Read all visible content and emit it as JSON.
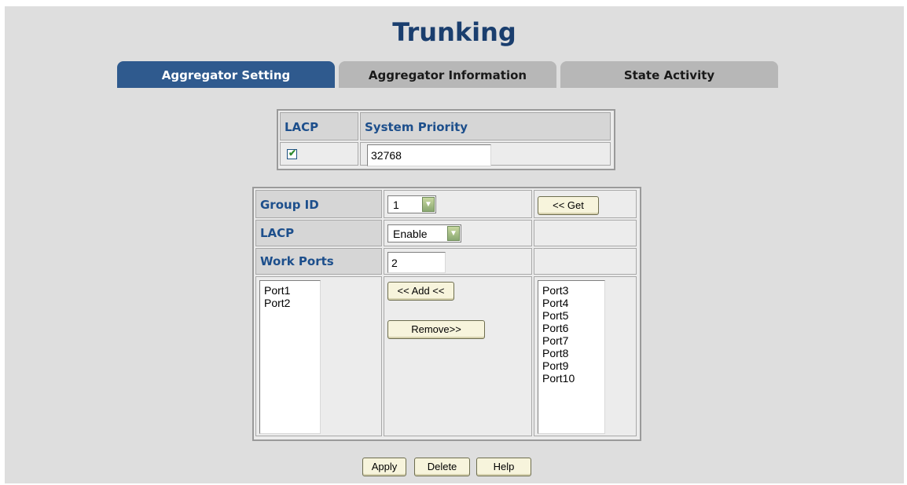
{
  "page": {
    "title": "Trunking"
  },
  "tabs": [
    {
      "label": "Aggregator Setting",
      "active": true
    },
    {
      "label": "Aggregator Information",
      "active": false
    },
    {
      "label": "State Activity",
      "active": false
    }
  ],
  "lacp_system": {
    "lacp_header": "LACP",
    "priority_header": "System Priority",
    "lacp_checked": true,
    "priority_value": "32768"
  },
  "group": {
    "group_id_label": "Group ID",
    "group_id_value": "1",
    "get_button": "<< Get",
    "lacp_label": "LACP",
    "lacp_value": "Enable",
    "work_ports_label": "Work Ports",
    "work_ports_value": "2",
    "member_ports": [
      "Port1",
      "Port2"
    ],
    "add_button": "<< Add <<",
    "remove_button": "Remove>>",
    "available_ports": [
      "Port3",
      "Port4",
      "Port5",
      "Port6",
      "Port7",
      "Port8",
      "Port9",
      "Port10"
    ]
  },
  "actions": {
    "apply": "Apply",
    "delete": "Delete",
    "help": "Help"
  },
  "colors": {
    "title": "#1a3e6e",
    "active_tab": "#2f5a8e",
    "inactive_tab": "#b7b7b7",
    "header_text": "#1d4f8c",
    "background": "#dedede"
  }
}
